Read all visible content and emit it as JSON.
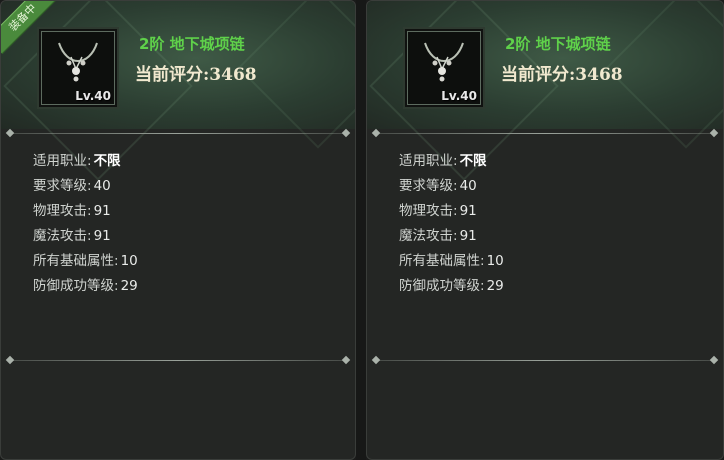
{
  "panels": [
    {
      "badge": "装备中",
      "item": {
        "name": "2阶 地下城项链",
        "score_label": "当前评分:",
        "score_value": "3468",
        "level": "Lv.40",
        "icon": "necklace-icon"
      },
      "stats": [
        {
          "label": "适用职业:",
          "value": "不限"
        },
        {
          "label": "要求等级:",
          "value": "40"
        },
        {
          "label": "物理攻击:",
          "value": "91"
        },
        {
          "label": "魔法攻击:",
          "value": "91"
        },
        {
          "label": "所有基础属性:",
          "value": "10"
        },
        {
          "label": "防御成功等级:",
          "value": "29"
        }
      ]
    },
    {
      "item": {
        "name": "2阶 地下城项链",
        "score_label": "当前评分:",
        "score_value": "3468",
        "level": "Lv.40",
        "icon": "necklace-icon"
      },
      "stats": [
        {
          "label": "适用职业:",
          "value": "不限"
        },
        {
          "label": "要求等级:",
          "value": "40"
        },
        {
          "label": "物理攻击:",
          "value": "91"
        },
        {
          "label": "魔法攻击:",
          "value": "91"
        },
        {
          "label": "所有基础属性:",
          "value": "10"
        },
        {
          "label": "防御成功等级:",
          "value": "29"
        }
      ]
    }
  ],
  "colors": {
    "item_name": "#5fd14a",
    "score": "#f1e9cf",
    "badge": "#4a8a3c",
    "panel_bg": "#242624"
  }
}
